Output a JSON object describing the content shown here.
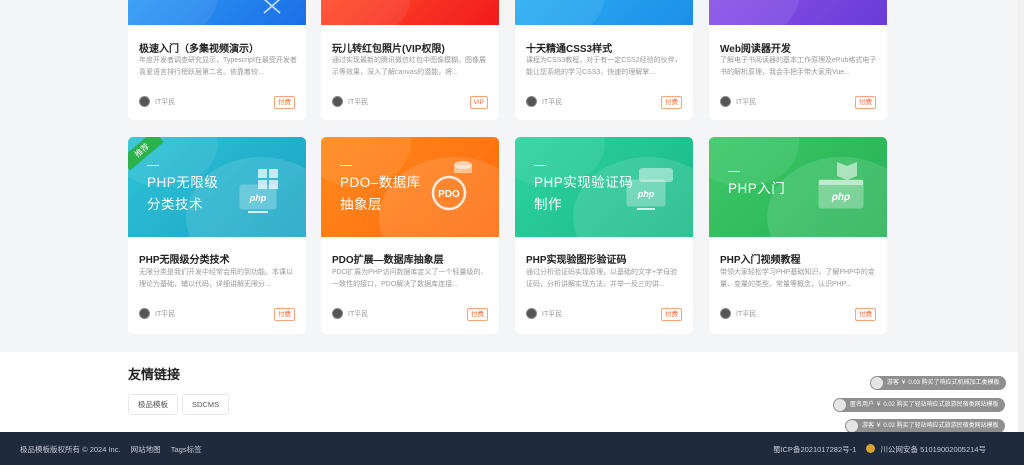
{
  "top_cards": [
    {
      "title": "极速入门（多集视频演示）",
      "desc": "年度开发者调查研究显示，Typescript在最受开发者喜爱语言排行榜跃居第二名。依靠着较...",
      "author": "IT平民",
      "tag": "付费",
      "gradient": [
        "#2f9cf5",
        "#1b6fe6"
      ]
    },
    {
      "title": "玩儿转红包照片(VIP权限)",
      "desc": "通过实现最新的腾讯微信红包中图像模糊，图像展示等效果，深入了解canvas的潜能，将...",
      "author": "IT平民",
      "tag": "VIP",
      "gradient": [
        "#ff4e2b",
        "#f11b1b"
      ]
    },
    {
      "title": "十天精通CSS3样式",
      "desc": "课程为CSS3教程，对于有一定CSS2经验的伙伴，能让您系统的学习CSS3，快速的理解掌...",
      "author": "IT平民",
      "tag": "付费",
      "gradient": [
        "#2ab0f2",
        "#1c8fe8"
      ]
    },
    {
      "title": "Web阅读器开发",
      "desc": "了解电子书阅读器的基本工作原理及ePub格式电子书的解析原理，我会手把手带大家用Vue...",
      "author": "IT平民",
      "tag": "付费",
      "gradient": [
        "#8a53e8",
        "#6a3bd8"
      ]
    }
  ],
  "bottom_cards": [
    {
      "thumb_line1": "PHP无限级",
      "thumb_line2": "分类技术",
      "title": "PHP无限级分类技术",
      "desc": "无限分类是我们开发中经常会用的到功能。本课以理论为基础，辅以代码，详细讲解无限分...",
      "author": "IT平民",
      "tag": "付费",
      "recommend": "推荐",
      "icon": "php-monitor-icon",
      "gradient": [
        "#2ec2d6",
        "#19a3c4"
      ]
    },
    {
      "thumb_line1": "PDO–数据库",
      "thumb_line2": "抽象层",
      "title": "PDO扩展—数据库抽象层",
      "desc": "PDO扩展为PHP访问数据库定义了一个轻量级的、一致性的接口，PDO解决了数据库连接...",
      "author": "IT平民",
      "tag": "付费",
      "recommend": "",
      "icon": "pdo-database-icon",
      "gradient": [
        "#ff8a1d",
        "#ff6a0d"
      ]
    },
    {
      "thumb_line1": "PHP实现验证码",
      "thumb_line2": "制作",
      "title": "PHP实现验图形验证码",
      "desc": "通过分析验证码实现原理，以基础的文字+字母验证码，分析讲解实现方法，并举一反三的讲...",
      "author": "IT平民",
      "tag": "付费",
      "recommend": "",
      "icon": "php-captcha-icon",
      "gradient": [
        "#2fd3a0",
        "#17b887"
      ]
    },
    {
      "thumb_line1": "PHP入门",
      "thumb_line2": "",
      "title": "PHP入门视频教程",
      "desc": "带领大家轻松学习PHP基础知识，了解PHP中的变量、变量的类型、常量等概念，认识PHP...",
      "author": "IT平民",
      "tag": "付费",
      "recommend": "",
      "icon": "php-book-icon",
      "gradient": [
        "#3dc86a",
        "#25b253"
      ]
    }
  ],
  "friends": {
    "title": "友情链接",
    "links": [
      "极品模板",
      "SDCMS"
    ]
  },
  "footer": {
    "copyright": "极品模板版权所有 © 2024 Inc.",
    "sitemap": "网站地图",
    "tags": "Tags标签",
    "icp": "蜀ICP备2021017282号-1",
    "police": "川公网安备 51019002005214号"
  },
  "toasts": [
    "游客 ￥ 0.03 购买了响应式机械加工类模板",
    "匿名用户 ￥ 0.02 购买了轻站响应式旅游民宿类网站模板",
    "游客 ￥ 0.02 购买了轻站响应式旅游民宿类网站模板"
  ]
}
